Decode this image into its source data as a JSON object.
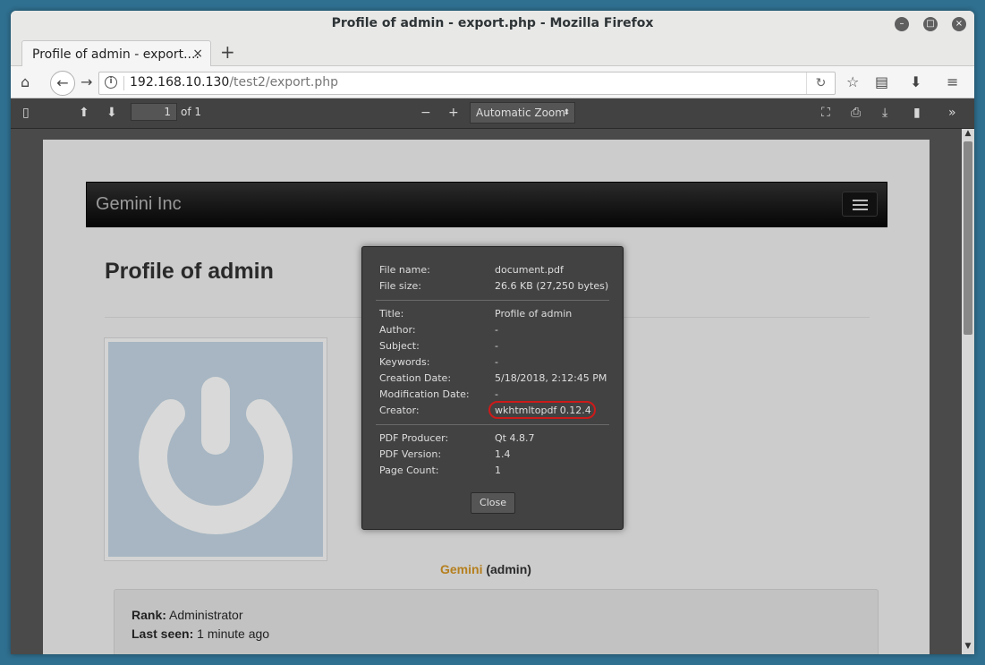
{
  "window": {
    "title": "Profile of admin - export.php - Mozilla Firefox"
  },
  "tab": {
    "label": "Profile of admin - export....",
    "close": "×",
    "new_tab": "+"
  },
  "nav": {
    "url_host": "192.168.10.130",
    "url_path": "/test2/export.php"
  },
  "pdf_toolbar": {
    "page_number": "1",
    "of_pages": "of 1",
    "zoom": "Automatic Zoom",
    "zoom_out": "−",
    "zoom_in": "+"
  },
  "page": {
    "brand": "Gemini Inc",
    "title": "Profile of admin",
    "user_name": "Gemini",
    "user_handle": "(admin)",
    "rank_label": "Rank:",
    "rank_value": "Administrator",
    "last_seen_label": "Last seen:",
    "last_seen_value": "1 minute ago"
  },
  "properties": {
    "file_name_label": "File name:",
    "file_name": "document.pdf",
    "file_size_label": "File size:",
    "file_size": "26.6 KB (27,250 bytes)",
    "title_label": "Title:",
    "title": "Profile of admin",
    "author_label": "Author:",
    "author": "-",
    "subject_label": "Subject:",
    "subject": "-",
    "keywords_label": "Keywords:",
    "keywords": "-",
    "creation_label": "Creation Date:",
    "creation": "5/18/2018, 2:12:45 PM",
    "modification_label": "Modification Date:",
    "modification": "-",
    "creator_label": "Creator:",
    "creator": "wkhtmltopdf 0.12.4",
    "producer_label": "PDF Producer:",
    "producer": "Qt 4.8.7",
    "version_label": "PDF Version:",
    "version": "1.4",
    "pagecount_label": "Page Count:",
    "pagecount": "1",
    "close": "Close"
  },
  "colors": {
    "highlight_ring": "#cc1a1a",
    "user_name": "#b57f1e"
  }
}
